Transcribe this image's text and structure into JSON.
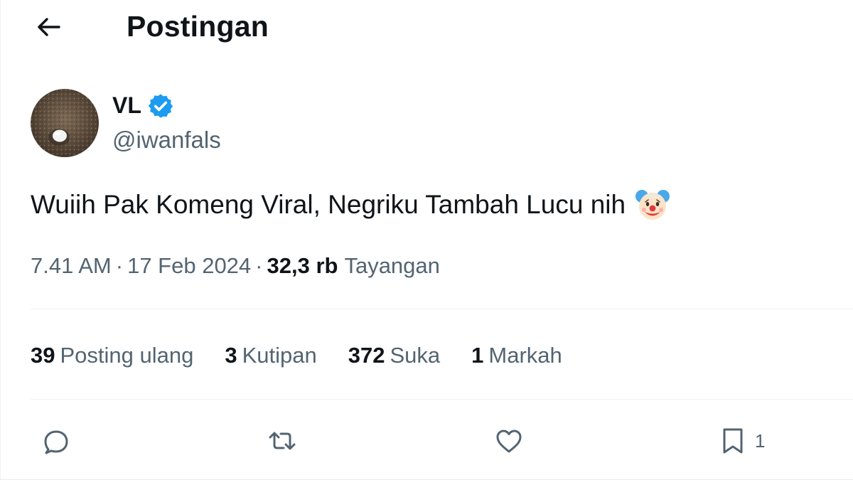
{
  "header": {
    "title": "Postingan",
    "back_icon": "arrow-left-icon"
  },
  "post": {
    "author": {
      "display_name": "VL",
      "handle": "@iwanfals",
      "verified_icon": "verified-badge-icon",
      "verified_color": "#1d9bf0"
    },
    "text": "Wuiih Pak Komeng Viral, Negriku Tambah Lucu nih",
    "emoji_icon": "clown-face-icon",
    "time": "7.41 AM",
    "date": "17 Feb 2024",
    "separator": "·",
    "views_count": "32,3 rb",
    "views_label": "Tayangan"
  },
  "stats": [
    {
      "count": "39",
      "label": "Posting ulang"
    },
    {
      "count": "3",
      "label": "Kutipan"
    },
    {
      "count": "372",
      "label": "Suka"
    },
    {
      "count": "1",
      "label": "Markah"
    }
  ],
  "actions": {
    "reply_icon": "reply-icon",
    "repost_icon": "repost-icon",
    "like_icon": "heart-icon",
    "bookmark_icon": "bookmark-icon",
    "bookmark_count": "1"
  },
  "colors": {
    "text_primary": "#0f1419",
    "text_secondary": "#536471",
    "accent": "#1d9bf0",
    "divider": "#eff3f4"
  }
}
